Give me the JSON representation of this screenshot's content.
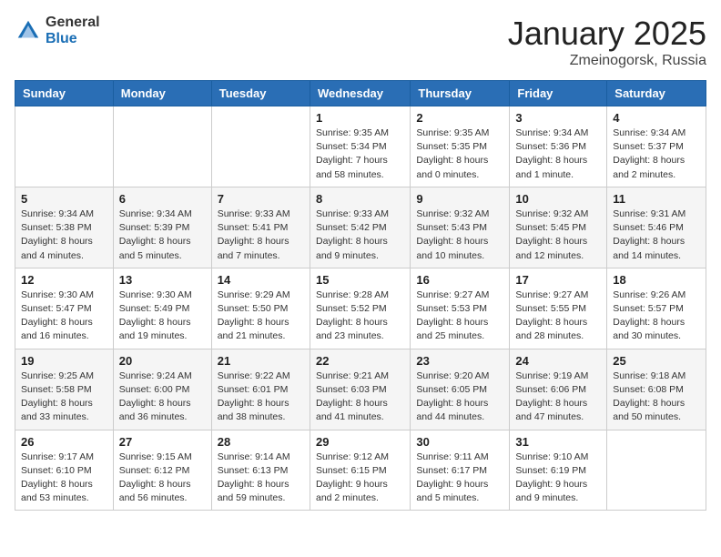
{
  "logo": {
    "general": "General",
    "blue": "Blue"
  },
  "header": {
    "title": "January 2025",
    "subtitle": "Zmeinogorsk, Russia"
  },
  "weekdays": [
    "Sunday",
    "Monday",
    "Tuesday",
    "Wednesday",
    "Thursday",
    "Friday",
    "Saturday"
  ],
  "weeks": [
    [
      null,
      null,
      null,
      {
        "day": 1,
        "sunrise": "9:35 AM",
        "sunset": "5:34 PM",
        "daylight": "7 hours and 58 minutes."
      },
      {
        "day": 2,
        "sunrise": "9:35 AM",
        "sunset": "5:35 PM",
        "daylight": "8 hours and 0 minutes."
      },
      {
        "day": 3,
        "sunrise": "9:34 AM",
        "sunset": "5:36 PM",
        "daylight": "8 hours and 1 minute."
      },
      {
        "day": 4,
        "sunrise": "9:34 AM",
        "sunset": "5:37 PM",
        "daylight": "8 hours and 2 minutes."
      }
    ],
    [
      {
        "day": 5,
        "sunrise": "9:34 AM",
        "sunset": "5:38 PM",
        "daylight": "8 hours and 4 minutes."
      },
      {
        "day": 6,
        "sunrise": "9:34 AM",
        "sunset": "5:39 PM",
        "daylight": "8 hours and 5 minutes."
      },
      {
        "day": 7,
        "sunrise": "9:33 AM",
        "sunset": "5:41 PM",
        "daylight": "8 hours and 7 minutes."
      },
      {
        "day": 8,
        "sunrise": "9:33 AM",
        "sunset": "5:42 PM",
        "daylight": "8 hours and 9 minutes."
      },
      {
        "day": 9,
        "sunrise": "9:32 AM",
        "sunset": "5:43 PM",
        "daylight": "8 hours and 10 minutes."
      },
      {
        "day": 10,
        "sunrise": "9:32 AM",
        "sunset": "5:45 PM",
        "daylight": "8 hours and 12 minutes."
      },
      {
        "day": 11,
        "sunrise": "9:31 AM",
        "sunset": "5:46 PM",
        "daylight": "8 hours and 14 minutes."
      }
    ],
    [
      {
        "day": 12,
        "sunrise": "9:30 AM",
        "sunset": "5:47 PM",
        "daylight": "8 hours and 16 minutes."
      },
      {
        "day": 13,
        "sunrise": "9:30 AM",
        "sunset": "5:49 PM",
        "daylight": "8 hours and 19 minutes."
      },
      {
        "day": 14,
        "sunrise": "9:29 AM",
        "sunset": "5:50 PM",
        "daylight": "8 hours and 21 minutes."
      },
      {
        "day": 15,
        "sunrise": "9:28 AM",
        "sunset": "5:52 PM",
        "daylight": "8 hours and 23 minutes."
      },
      {
        "day": 16,
        "sunrise": "9:27 AM",
        "sunset": "5:53 PM",
        "daylight": "8 hours and 25 minutes."
      },
      {
        "day": 17,
        "sunrise": "9:27 AM",
        "sunset": "5:55 PM",
        "daylight": "8 hours and 28 minutes."
      },
      {
        "day": 18,
        "sunrise": "9:26 AM",
        "sunset": "5:57 PM",
        "daylight": "8 hours and 30 minutes."
      }
    ],
    [
      {
        "day": 19,
        "sunrise": "9:25 AM",
        "sunset": "5:58 PM",
        "daylight": "8 hours and 33 minutes."
      },
      {
        "day": 20,
        "sunrise": "9:24 AM",
        "sunset": "6:00 PM",
        "daylight": "8 hours and 36 minutes."
      },
      {
        "day": 21,
        "sunrise": "9:22 AM",
        "sunset": "6:01 PM",
        "daylight": "8 hours and 38 minutes."
      },
      {
        "day": 22,
        "sunrise": "9:21 AM",
        "sunset": "6:03 PM",
        "daylight": "8 hours and 41 minutes."
      },
      {
        "day": 23,
        "sunrise": "9:20 AM",
        "sunset": "6:05 PM",
        "daylight": "8 hours and 44 minutes."
      },
      {
        "day": 24,
        "sunrise": "9:19 AM",
        "sunset": "6:06 PM",
        "daylight": "8 hours and 47 minutes."
      },
      {
        "day": 25,
        "sunrise": "9:18 AM",
        "sunset": "6:08 PM",
        "daylight": "8 hours and 50 minutes."
      }
    ],
    [
      {
        "day": 26,
        "sunrise": "9:17 AM",
        "sunset": "6:10 PM",
        "daylight": "8 hours and 53 minutes."
      },
      {
        "day": 27,
        "sunrise": "9:15 AM",
        "sunset": "6:12 PM",
        "daylight": "8 hours and 56 minutes."
      },
      {
        "day": 28,
        "sunrise": "9:14 AM",
        "sunset": "6:13 PM",
        "daylight": "8 hours and 59 minutes."
      },
      {
        "day": 29,
        "sunrise": "9:12 AM",
        "sunset": "6:15 PM",
        "daylight": "9 hours and 2 minutes."
      },
      {
        "day": 30,
        "sunrise": "9:11 AM",
        "sunset": "6:17 PM",
        "daylight": "9 hours and 5 minutes."
      },
      {
        "day": 31,
        "sunrise": "9:10 AM",
        "sunset": "6:19 PM",
        "daylight": "9 hours and 9 minutes."
      },
      null
    ]
  ]
}
